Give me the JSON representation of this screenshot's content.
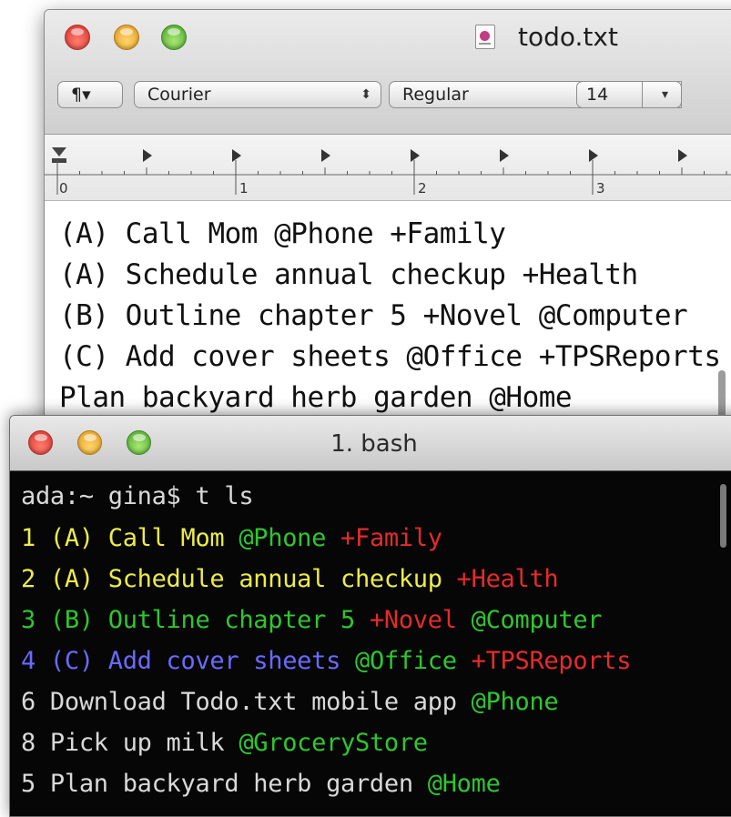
{
  "editor": {
    "title": "todo.txt",
    "toolbar": {
      "paragraph_label": "¶▾",
      "font_family": "Courier",
      "font_style": "Regular",
      "font_size": "14",
      "popup_arrow": "▾",
      "stepper_arrows": "⬍",
      "color_swatch": "#000000"
    },
    "ruler": {
      "tab_stops": "right-arrow tab stops",
      "numbers": [
        "0",
        "1",
        "2",
        "3"
      ]
    },
    "lines": [
      "(A) Call Mom @Phone +Family",
      "(A) Schedule annual checkup +Health",
      "(B) Outline chapter 5 +Novel @Computer",
      "(C) Add cover sheets @Office +TPSReports",
      "Plan backyard herb garden @Home"
    ]
  },
  "terminal": {
    "title": "1. bash",
    "prompt_line": "ada:~ gina$ t ls",
    "lines": [
      {
        "segments": [
          {
            "text": "1 (A) Call Mom ",
            "color": "#ecec4a"
          },
          {
            "text": "@Phone ",
            "color": "#2fc62f"
          },
          {
            "text": "+Family",
            "color": "#e52b2b"
          }
        ]
      },
      {
        "segments": [
          {
            "text": "2 (A) Schedule annual checkup ",
            "color": "#ecec4a"
          },
          {
            "text": "+Health",
            "color": "#e52b2b"
          }
        ]
      },
      {
        "segments": [
          {
            "text": "3 (B) Outline chapter 5 ",
            "color": "#2fc62f"
          },
          {
            "text": "+Novel ",
            "color": "#e52b2b"
          },
          {
            "text": "@Computer",
            "color": "#2fc62f"
          }
        ]
      },
      {
        "segments": [
          {
            "text": "4 (C) Add cover sheets ",
            "color": "#6a6aff"
          },
          {
            "text": "@Office ",
            "color": "#2fc62f"
          },
          {
            "text": "+TPSReports",
            "color": "#e52b2b"
          }
        ]
      },
      {
        "segments": [
          {
            "text": "6 Download Todo.txt mobile app ",
            "color": "#d9d9d9"
          },
          {
            "text": "@Phone",
            "color": "#2fc62f"
          }
        ]
      },
      {
        "segments": [
          {
            "text": "8 Pick up milk ",
            "color": "#d9d9d9"
          },
          {
            "text": "@GroceryStore",
            "color": "#2fc62f"
          }
        ]
      },
      {
        "segments": [
          {
            "text": "5 Plan backyard herb garden ",
            "color": "#d9d9d9"
          },
          {
            "text": "@Home",
            "color": "#2fc62f"
          }
        ]
      }
    ]
  }
}
